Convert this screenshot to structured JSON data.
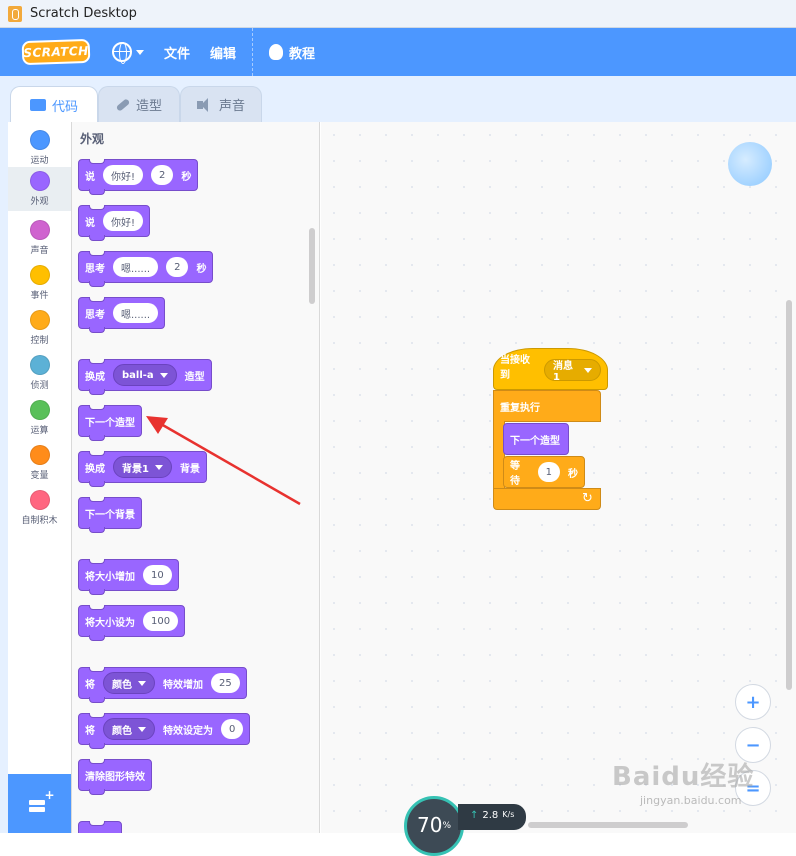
{
  "window": {
    "title": "Scratch Desktop"
  },
  "menubar": {
    "logo_text": "SCRATCH",
    "file": "文件",
    "edit": "编辑",
    "tutorials": "教程"
  },
  "tabs": [
    {
      "label": "代码",
      "active": true
    },
    {
      "label": "造型",
      "active": false
    },
    {
      "label": "声音",
      "active": false
    }
  ],
  "categories": [
    {
      "label": "运动",
      "color": "#4c97ff"
    },
    {
      "label": "外观",
      "color": "#9966ff",
      "selected": true
    },
    {
      "label": "声音",
      "color": "#cf63cf"
    },
    {
      "label": "事件",
      "color": "#ffbf00"
    },
    {
      "label": "控制",
      "color": "#ffab19"
    },
    {
      "label": "侦测",
      "color": "#5cb1d6"
    },
    {
      "label": "运算",
      "color": "#59c059"
    },
    {
      "label": "变量",
      "color": "#ff8c1a"
    },
    {
      "label": "自制积木",
      "color": "#ff6680"
    }
  ],
  "palette": {
    "title": "外观",
    "blocks": {
      "say_for": {
        "say": "说",
        "text": "你好!",
        "secs": "2",
        "unit": "秒"
      },
      "say": {
        "say": "说",
        "text": "你好!"
      },
      "think_for": {
        "think": "思考",
        "text": "嗯......",
        "secs": "2",
        "unit": "秒"
      },
      "think": {
        "think": "思考",
        "text": "嗯......"
      },
      "switch_costume": {
        "pre": "换成",
        "costume": "ball-a",
        "post": "造型"
      },
      "next_costume": {
        "label": "下一个造型"
      },
      "switch_backdrop": {
        "pre": "换成",
        "backdrop": "背景1",
        "post": "背景"
      },
      "next_backdrop": {
        "label": "下一个背景"
      },
      "change_size": {
        "label": "将大小增加",
        "value": "10"
      },
      "set_size": {
        "label": "将大小设为",
        "value": "100"
      },
      "change_effect": {
        "pre": "将",
        "effect": "颜色",
        "mid": "特效增加",
        "value": "25"
      },
      "set_effect": {
        "pre": "将",
        "effect": "颜色",
        "mid": "特效设定为",
        "value": "0"
      },
      "clear_effects": {
        "label": "清除图形特效"
      }
    }
  },
  "script": {
    "hat": {
      "label": "当接收到",
      "message": "消息1"
    },
    "forever": {
      "label": "重复执行"
    },
    "next_costume": {
      "label": "下一个造型"
    },
    "wait": {
      "label": "等待",
      "value": "1",
      "unit": "秒"
    }
  },
  "zoom": {
    "in": "+",
    "out": "−",
    "reset": "="
  },
  "watermark": {
    "main": "Baidu经验",
    "sub": "jingyan.baidu.com"
  },
  "netmeter": {
    "percent": "70",
    "percent_sign": "%",
    "speed": "2.8",
    "unit": "K/s"
  }
}
